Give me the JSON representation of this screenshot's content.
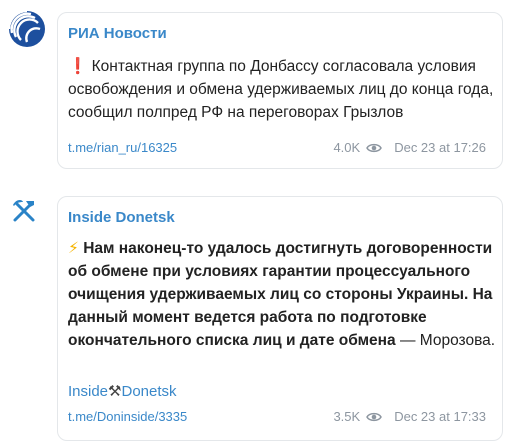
{
  "posts": [
    {
      "channel": "РИА Новости",
      "avatar_icon": "ria-globe-logo-icon",
      "emoji": "❗",
      "text": "Контактная группа по Донбассу согласовала условия освобождения и обмена удерживаемых лиц до конца года, сообщил полпред РФ на переговорах Грызлов",
      "link": "t.me/rian_ru/16325",
      "views": "4.0K",
      "date": "Dec 23 at 17:26",
      "colors": {
        "avatar_bg": "#1d4f9e",
        "accent": "#3a88c9"
      }
    },
    {
      "channel": "Inside Donetsk",
      "avatar_icon": "hammer-pick-icon",
      "emoji": "⚡",
      "text_bold": "Нам наконец-то удалось достигнуть договоренности об обмене при условиях гарантии процессуального очищения удерживаемых лиц со стороны Украины. На данный момент ведется работа по подготовке окончательного списка лиц и дате обмена",
      "text_rest": " — Морозова.",
      "signature_left": "Inside",
      "signature_emoji": "⚒",
      "signature_right": "Donetsk",
      "link": "t.me/Doninside/3335",
      "views": "3.5K",
      "date": "Dec 23 at 17:33"
    }
  ]
}
